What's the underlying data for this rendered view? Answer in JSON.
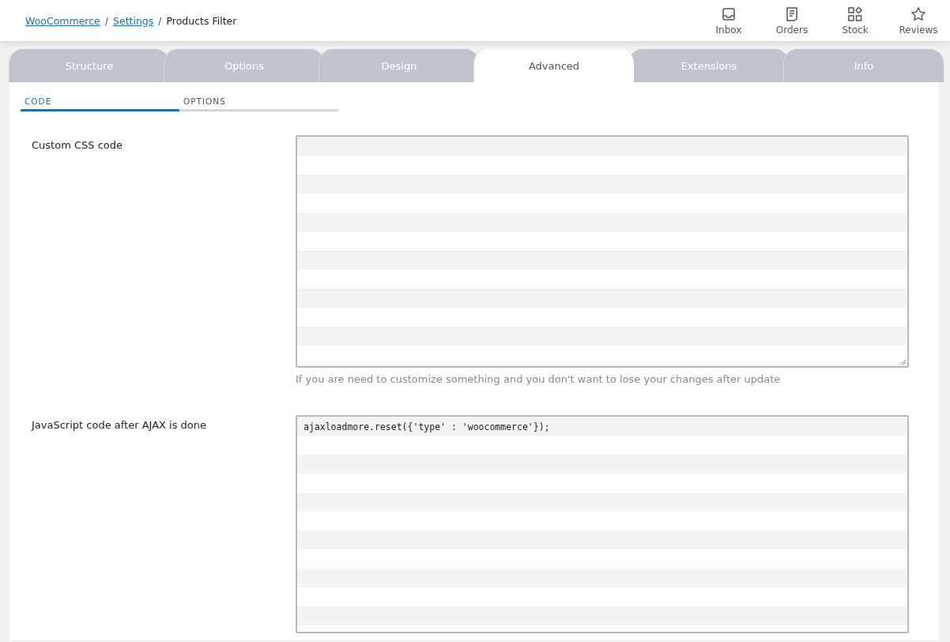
{
  "breadcrumbs": [
    {
      "label": "WooCommerce",
      "kind": "link"
    },
    {
      "label": "/",
      "kind": "separator"
    },
    {
      "label": "Settings",
      "kind": "link"
    },
    {
      "label": "/",
      "kind": "separator"
    },
    {
      "label": "Products Filter",
      "kind": "current"
    }
  ],
  "header_actions": [
    {
      "label": "Inbox",
      "kind": "inbox"
    },
    {
      "label": "Orders",
      "kind": "orders"
    },
    {
      "label": "Stock",
      "kind": "stock"
    },
    {
      "label": "Reviews",
      "kind": "reviews"
    }
  ],
  "tabs": [
    {
      "label": "Structure",
      "selected": false
    },
    {
      "label": "Options",
      "selected": false
    },
    {
      "label": "Design",
      "selected": false
    },
    {
      "label": "Advanced",
      "selected": true
    },
    {
      "label": "Extensions",
      "selected": false
    },
    {
      "label": "Info",
      "selected": false
    }
  ],
  "subtabs": [
    {
      "label": "CODE",
      "selected": true
    },
    {
      "label": "OPTIONS",
      "selected": false
    }
  ],
  "fields": [
    {
      "label": "Custom CSS code",
      "hint": "If you are need to customize something and you don't want to lose your changes after update"
    },
    {
      "label": "JavaScript code after AJAX is done",
      "value": "ajaxloadmore.reset({'type' : 'woocommerce'});"
    }
  ]
}
